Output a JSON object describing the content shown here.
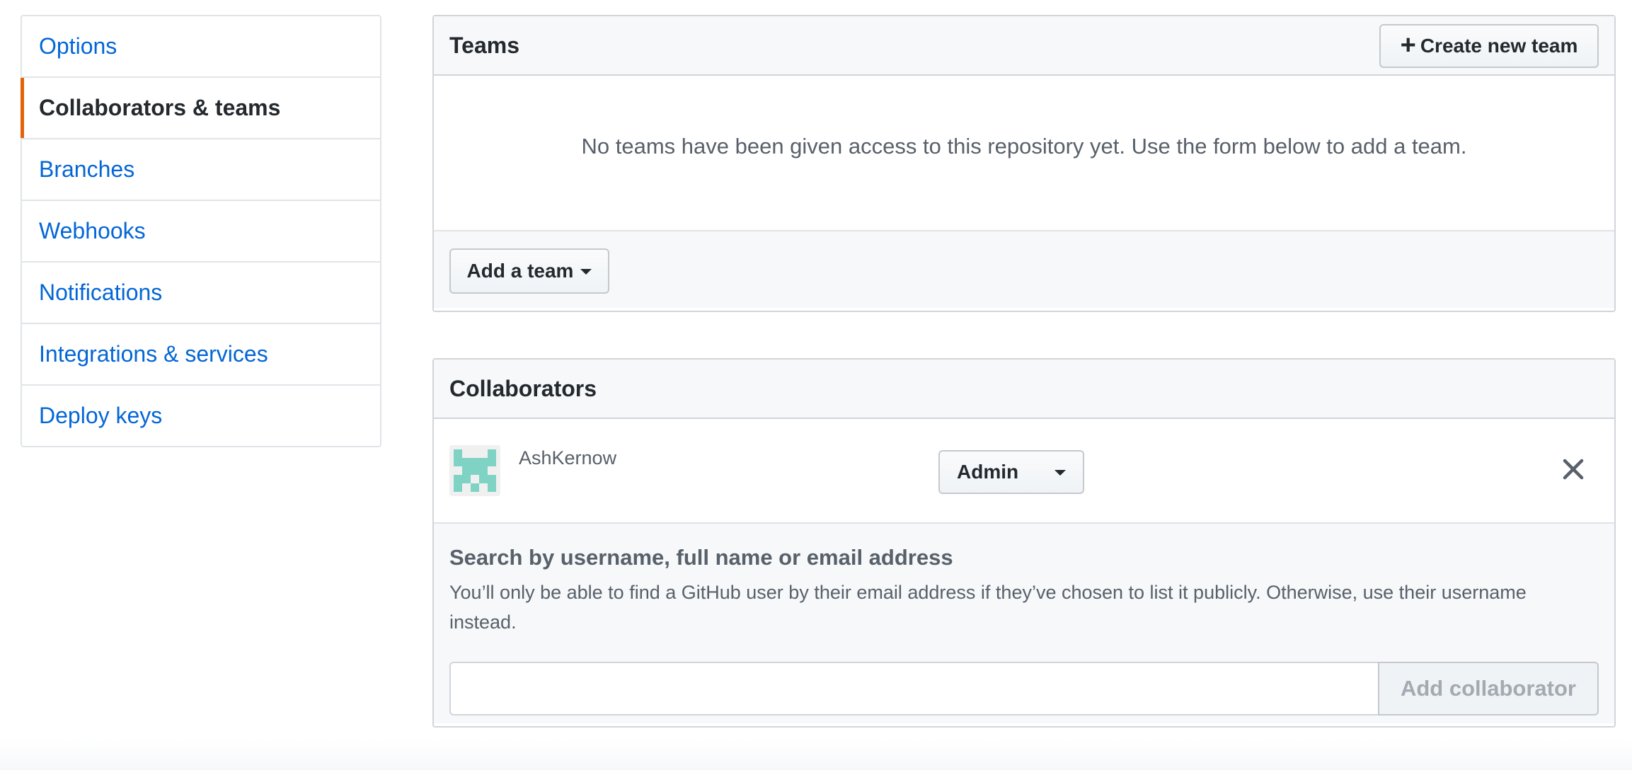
{
  "sidebar": {
    "items": [
      {
        "label": "Options",
        "selected": false
      },
      {
        "label": "Collaborators & teams",
        "selected": true
      },
      {
        "label": "Branches",
        "selected": false
      },
      {
        "label": "Webhooks",
        "selected": false
      },
      {
        "label": "Notifications",
        "selected": false
      },
      {
        "label": "Integrations & services",
        "selected": false
      },
      {
        "label": "Deploy keys",
        "selected": false
      }
    ],
    "accent_color": "#e36209",
    "link_color": "#0366d6"
  },
  "teams": {
    "title": "Teams",
    "create_button": "Create new team",
    "create_icon": "plus-icon",
    "blankslate": "No teams have been given access to this repository yet. Use the form below to add a team.",
    "add_team_button": "Add a team"
  },
  "collaborators": {
    "title": "Collaborators",
    "members": [
      {
        "username": "AshKernow",
        "role": "Admin",
        "avatar_color": "#7fd3c4"
      }
    ],
    "search": {
      "title": "Search by username, full name or email address",
      "note": "You’ll only be able to find a GitHub user by their email address if they’ve chosen to list it publicly. Otherwise, use their username instead.",
      "input_value": "",
      "placeholder": "",
      "add_button": "Add collaborator"
    }
  }
}
